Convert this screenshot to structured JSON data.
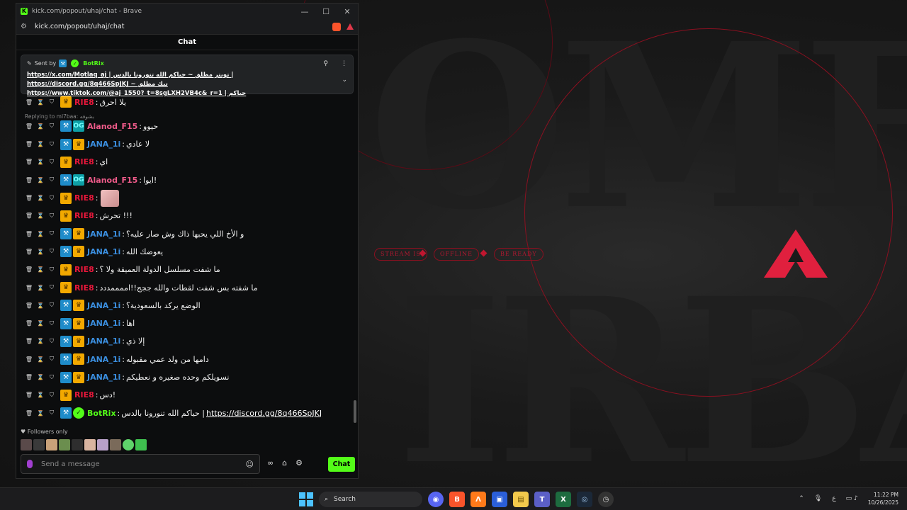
{
  "window": {
    "title": "kick.com/popout/uhaj/chat - Brave",
    "url": "kick.com/popout/uhaj/chat",
    "controls": [
      "—",
      "☐",
      "✕"
    ]
  },
  "chat": {
    "header": "Chat",
    "pinned": {
      "sent_by_label": "Sent by",
      "sender": "BotRix",
      "line1": "https://x.com/Motlaq_aj | تويتر مطلق ~ حياكم الله تنورونا بالدس | https://discord.gg/8q466SpJKJ ~ تيك مطلق",
      "line2": "https://www.tiktok.com/@aj_1550?_t=8sgLXH2VB4c&_r=1 | حياكم"
    },
    "reply_label": "Replying to ml7baa: بشوفه",
    "messages": [
      {
        "user": "RIE8",
        "color": "#e8173a",
        "badges": [
          "crown"
        ],
        "text": "يلا احرق"
      },
      {
        "user": "Alanod_F15",
        "color": "#f05b8a",
        "badges": [
          "mod",
          "og"
        ],
        "text": "حيوو"
      },
      {
        "user": "JANA_1i",
        "color": "#3b8fe0",
        "badges": [
          "mod",
          "crown"
        ],
        "text": "لا عادي"
      },
      {
        "user": "RIE8",
        "color": "#e8173a",
        "badges": [
          "crown"
        ],
        "text": "اي"
      },
      {
        "user": "Alanod_F15",
        "color": "#f05b8a",
        "badges": [
          "mod",
          "og"
        ],
        "text": "ايوا!"
      },
      {
        "user": "RIE8",
        "color": "#e8173a",
        "badges": [
          "crown"
        ],
        "text": "",
        "emote": true
      },
      {
        "user": "RIE8",
        "color": "#e8173a",
        "badges": [
          "crown"
        ],
        "text": "تحرش !!!"
      },
      {
        "user": "JANA_1i",
        "color": "#3b8fe0",
        "badges": [
          "mod",
          "crown"
        ],
        "text": "و الأخ اللي يحبها ذاك وش صار عليه؟"
      },
      {
        "user": "JANA_1i",
        "color": "#3b8fe0",
        "badges": [
          "mod",
          "crown"
        ],
        "text": "يعوضك الله"
      },
      {
        "user": "RIE8",
        "color": "#e8173a",
        "badges": [
          "crown"
        ],
        "text": "ما شفت مسلسل الدولة العميقة ولا ؟"
      },
      {
        "user": "RIE8",
        "color": "#e8173a",
        "badges": [
          "crown"
        ],
        "text": "ما شفته بس شفت لقطات والله ججج!!اممممددد"
      },
      {
        "user": "JANA_1i",
        "color": "#3b8fe0",
        "badges": [
          "mod",
          "crown"
        ],
        "text": "الوضع يركد بالسعودية؟"
      },
      {
        "user": "JANA_1i",
        "color": "#3b8fe0",
        "badges": [
          "mod",
          "crown"
        ],
        "text": "اها"
      },
      {
        "user": "JANA_1i",
        "color": "#3b8fe0",
        "badges": [
          "mod",
          "crown"
        ],
        "text": "إلا ذي"
      },
      {
        "user": "JANA_1i",
        "color": "#3b8fe0",
        "badges": [
          "mod",
          "crown"
        ],
        "text": "دامها من ولد عمي مقبوله"
      },
      {
        "user": "JANA_1i",
        "color": "#3b8fe0",
        "badges": [
          "mod",
          "crown"
        ],
        "text": "نسويلكم وحده صغيره و نعطيكم"
      },
      {
        "user": "RIE8",
        "color": "#e8173a",
        "badges": [
          "crown"
        ],
        "text": "دس!"
      },
      {
        "user": "BotRix",
        "color": "#53fc18",
        "badges": [
          "mod",
          "verified"
        ],
        "text": "حياكم الله تنورونا بالدس |",
        "link": "https://discord.gg/8q466SpJKJ"
      }
    ],
    "followers_only": "Followers only",
    "input_placeholder": "Send a message",
    "send_label": "Chat"
  },
  "stream_art": {
    "top_text": "OME",
    "bottom_text": "IRBA",
    "pills": [
      "STREAM IS",
      "OFFLINE",
      "BE READY"
    ],
    "accent": "#c0162f"
  },
  "taskbar": {
    "search_label": "Search",
    "lang": "ع",
    "time": "11:22 PM",
    "date": "10/26/2025"
  }
}
